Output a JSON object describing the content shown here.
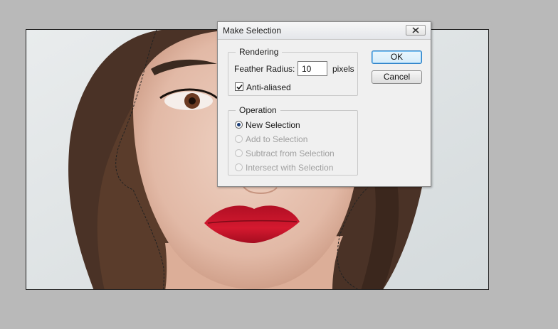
{
  "dialog": {
    "title": "Make Selection",
    "rendering": {
      "legend": "Rendering",
      "feather_label": "Feather Radius:",
      "feather_value": "10",
      "feather_unit": "pixels",
      "antialiased_label": "Anti-aliased",
      "antialiased_checked": true
    },
    "operation": {
      "legend": "Operation",
      "options": [
        {
          "label": "New Selection",
          "checked": true,
          "enabled": true
        },
        {
          "label": "Add to Selection",
          "checked": false,
          "enabled": false
        },
        {
          "label": "Subtract from Selection",
          "checked": false,
          "enabled": false
        },
        {
          "label": "Intersect with Selection",
          "checked": false,
          "enabled": false
        }
      ]
    },
    "buttons": {
      "ok": "OK",
      "cancel": "Cancel"
    }
  },
  "icons": {
    "close": "close-icon",
    "check": "checkmark-icon"
  },
  "colors": {
    "workspace": "#b9b9b9",
    "dialog_bg": "#f0f0f0",
    "ok_border": "#2c7fc6",
    "lips": "#c8142a"
  }
}
